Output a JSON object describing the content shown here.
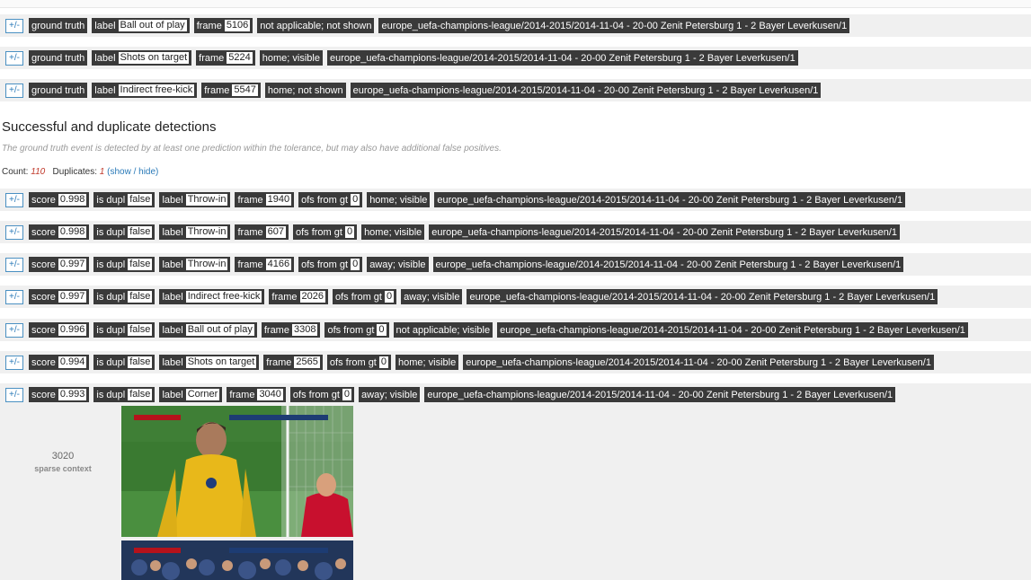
{
  "toggle_label": "+/-",
  "colors": {
    "dark_tag": "#3a3a3a",
    "link": "#2a7ab8",
    "count_red": "#c0392b",
    "row_bg": "#f0f0f0"
  },
  "gt_rows": [
    {
      "kind": "ground truth",
      "label_key": "label",
      "label": "Ball out of play",
      "frame_key": "frame",
      "frame": "5106",
      "vis": "not applicable; not shown",
      "game": "europe_uefa-champions-league/2014-2015/2014-11-04 - 20-00 Zenit Petersburg 1 - 2 Bayer Leverkusen/1"
    },
    {
      "kind": "ground truth",
      "label_key": "label",
      "label": "Shots on target",
      "frame_key": "frame",
      "frame": "5224",
      "vis": "home; visible",
      "game": "europe_uefa-champions-league/2014-2015/2014-11-04 - 20-00 Zenit Petersburg 1 - 2 Bayer Leverkusen/1"
    },
    {
      "kind": "ground truth",
      "label_key": "label",
      "label": "Indirect free-kick",
      "frame_key": "frame",
      "frame": "5547",
      "vis": "home; not shown",
      "game": "europe_uefa-champions-league/2014-2015/2014-11-04 - 20-00 Zenit Petersburg 1 - 2 Bayer Leverkusen/1"
    }
  ],
  "section": {
    "title": "Successful and duplicate detections",
    "description": "The ground truth event is detected by at least one prediction within the tolerance, but may also have additional false positives.",
    "count_label": "Count:",
    "count": "110",
    "dup_label": "Duplicates:",
    "dup": "1",
    "show_hide": "(show / hide)"
  },
  "det_rows": [
    {
      "score_key": "score",
      "score": "0.998",
      "dupl_key": "is dupl",
      "dupl": "false",
      "label_key": "label",
      "label": "Throw-in",
      "frame_key": "frame",
      "frame": "1940",
      "ofs_key": "ofs from gt",
      "ofs": "0",
      "vis": "home; visible",
      "game": "europe_uefa-champions-league/2014-2015/2014-11-04 - 20-00 Zenit Petersburg 1 - 2 Bayer Leverkusen/1"
    },
    {
      "score_key": "score",
      "score": "0.998",
      "dupl_key": "is dupl",
      "dupl": "false",
      "label_key": "label",
      "label": "Throw-in",
      "frame_key": "frame",
      "frame": "607",
      "ofs_key": "ofs from gt",
      "ofs": "0",
      "vis": "home; visible",
      "game": "europe_uefa-champions-league/2014-2015/2014-11-04 - 20-00 Zenit Petersburg 1 - 2 Bayer Leverkusen/1"
    },
    {
      "score_key": "score",
      "score": "0.997",
      "dupl_key": "is dupl",
      "dupl": "false",
      "label_key": "label",
      "label": "Throw-in",
      "frame_key": "frame",
      "frame": "4166",
      "ofs_key": "ofs from gt",
      "ofs": "0",
      "vis": "away; visible",
      "game": "europe_uefa-champions-league/2014-2015/2014-11-04 - 20-00 Zenit Petersburg 1 - 2 Bayer Leverkusen/1"
    },
    {
      "score_key": "score",
      "score": "0.997",
      "dupl_key": "is dupl",
      "dupl": "false",
      "label_key": "label",
      "label": "Indirect free-kick",
      "frame_key": "frame",
      "frame": "2026",
      "ofs_key": "ofs from gt",
      "ofs": "0",
      "vis": "away; visible",
      "game": "europe_uefa-champions-league/2014-2015/2014-11-04 - 20-00 Zenit Petersburg 1 - 2 Bayer Leverkusen/1"
    },
    {
      "score_key": "score",
      "score": "0.996",
      "dupl_key": "is dupl",
      "dupl": "false",
      "label_key": "label",
      "label": "Ball out of play",
      "frame_key": "frame",
      "frame": "3308",
      "ofs_key": "ofs from gt",
      "ofs": "0",
      "vis": "not applicable; visible",
      "game": "europe_uefa-champions-league/2014-2015/2014-11-04 - 20-00 Zenit Petersburg 1 - 2 Bayer Leverkusen/1"
    },
    {
      "score_key": "score",
      "score": "0.994",
      "dupl_key": "is dupl",
      "dupl": "false",
      "label_key": "label",
      "label": "Shots on target",
      "frame_key": "frame",
      "frame": "2565",
      "ofs_key": "ofs from gt",
      "ofs": "0",
      "vis": "home; visible",
      "game": "europe_uefa-champions-league/2014-2015/2014-11-04 - 20-00 Zenit Petersburg 1 - 2 Bayer Leverkusen/1"
    },
    {
      "score_key": "score",
      "score": "0.993",
      "dupl_key": "is dupl",
      "dupl": "false",
      "label_key": "label",
      "label": "Corner",
      "frame_key": "frame",
      "frame": "3040",
      "ofs_key": "ofs from gt",
      "ofs": "0",
      "vis": "away; visible",
      "game": "europe_uefa-champions-league/2014-2015/2014-11-04 - 20-00 Zenit Petersburg 1 - 2 Bayer Leverkusen/1"
    }
  ],
  "context": {
    "frame_number": "3020",
    "label": "sparse context"
  }
}
